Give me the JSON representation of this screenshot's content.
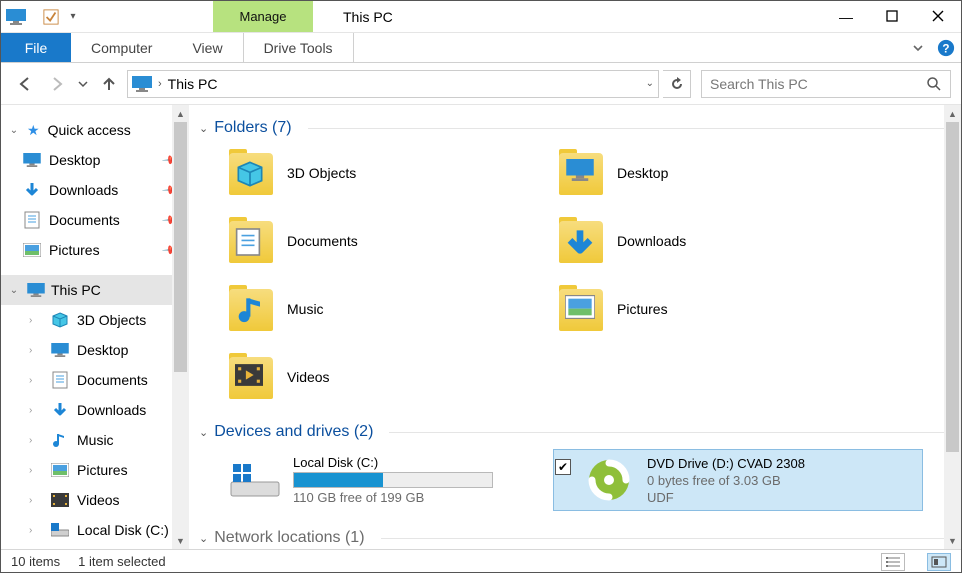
{
  "window": {
    "title": "This PC",
    "manage_label": "Manage"
  },
  "ribbon": {
    "file": "File",
    "tabs": [
      "Computer",
      "View"
    ],
    "contextual": "Drive Tools"
  },
  "nav": {
    "address_crumb": "This PC",
    "search_placeholder": "Search This PC"
  },
  "sidebar": {
    "quick_access": {
      "label": "Quick access",
      "items": [
        {
          "label": "Desktop",
          "icon": "monitor"
        },
        {
          "label": "Downloads",
          "icon": "down"
        },
        {
          "label": "Documents",
          "icon": "doc"
        },
        {
          "label": "Pictures",
          "icon": "pic"
        }
      ]
    },
    "this_pc": {
      "label": "This PC",
      "items": [
        {
          "label": "3D Objects",
          "icon": "cube"
        },
        {
          "label": "Desktop",
          "icon": "monitor"
        },
        {
          "label": "Documents",
          "icon": "doc"
        },
        {
          "label": "Downloads",
          "icon": "down"
        },
        {
          "label": "Music",
          "icon": "music"
        },
        {
          "label": "Pictures",
          "icon": "pic"
        },
        {
          "label": "Videos",
          "icon": "video"
        },
        {
          "label": "Local Disk (C:)",
          "icon": "disk"
        }
      ]
    }
  },
  "groups": {
    "folders": {
      "title": "Folders",
      "count": 7,
      "items": [
        "3D Objects",
        "Desktop",
        "Documents",
        "Downloads",
        "Music",
        "Pictures",
        "Videos"
      ]
    },
    "drives": {
      "title": "Devices and drives",
      "count": 2,
      "local": {
        "name": "Local Disk (C:)",
        "free_text": "110 GB free of 199 GB",
        "fill_percent": 45
      },
      "dvd": {
        "name": "DVD Drive (D:) CVAD 2308",
        "free_text": "0 bytes free of 3.03 GB",
        "fs": "UDF"
      }
    },
    "network": {
      "title": "Network locations",
      "count": 1
    }
  },
  "status": {
    "items": "10 items",
    "selected": "1 item selected"
  }
}
